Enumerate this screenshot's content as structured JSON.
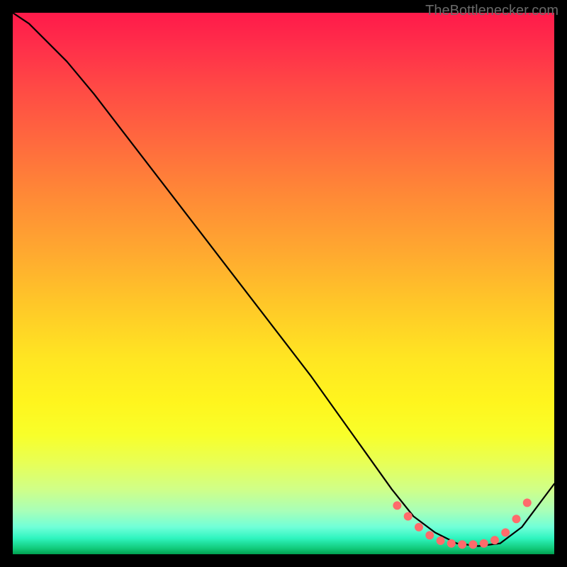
{
  "watermark": "TheBottlenecker.com",
  "chart_data": {
    "type": "line",
    "title": "",
    "xlabel": "",
    "ylabel": "",
    "xlim": [
      0,
      100
    ],
    "ylim": [
      0,
      100
    ],
    "series": [
      {
        "name": "curve",
        "x": [
          0,
          3,
          6,
          10,
          15,
          20,
          25,
          30,
          35,
          40,
          45,
          50,
          55,
          60,
          65,
          70,
          74,
          78,
          82,
          86,
          90,
          94,
          97,
          100
        ],
        "y": [
          100,
          98,
          95,
          91,
          85,
          78.5,
          72,
          65.5,
          59,
          52.5,
          46,
          39.5,
          33,
          26,
          19,
          12,
          7,
          4,
          2,
          1.5,
          2,
          5,
          9,
          13
        ]
      }
    ],
    "markers": {
      "name": "highlight-points",
      "color": "#ff6b6b",
      "x": [
        71,
        73,
        75,
        77,
        79,
        81,
        83,
        85,
        87,
        89,
        91,
        93,
        95
      ],
      "y": [
        9,
        7,
        5,
        3.5,
        2.5,
        2,
        1.8,
        1.8,
        2,
        2.6,
        4,
        6.5,
        9.5
      ]
    }
  }
}
